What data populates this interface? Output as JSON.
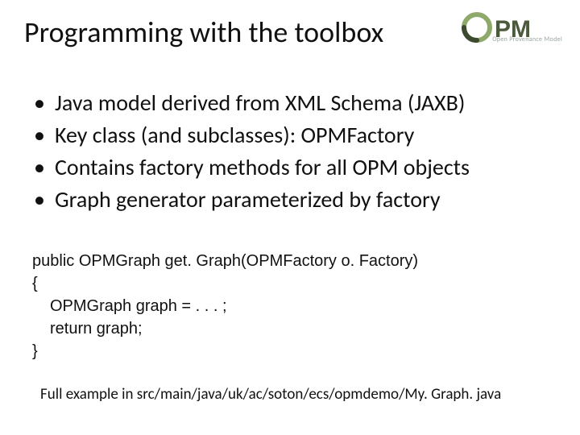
{
  "title": "Programming with the toolbox",
  "logo": {
    "acronym_top": "PM",
    "acronym_o": "O",
    "subtitle": "Open Provenance Model"
  },
  "bullets": [
    "Java model derived from XML Schema (JAXB)",
    "Key class (and subclasses): OPMFactory",
    "Contains factory methods for all OPM objects",
    "Graph generator parameterized by factory"
  ],
  "code": {
    "line1": "public OPMGraph get. Graph(OPMFactory o. Factory)",
    "line2": "{",
    "line3": "OPMGraph graph = . . . ;",
    "line4": "return graph;",
    "line5": "}"
  },
  "footnote": "Full example in src/main/java/uk/ac/soton/ecs/opmdemo/My. Graph. java"
}
